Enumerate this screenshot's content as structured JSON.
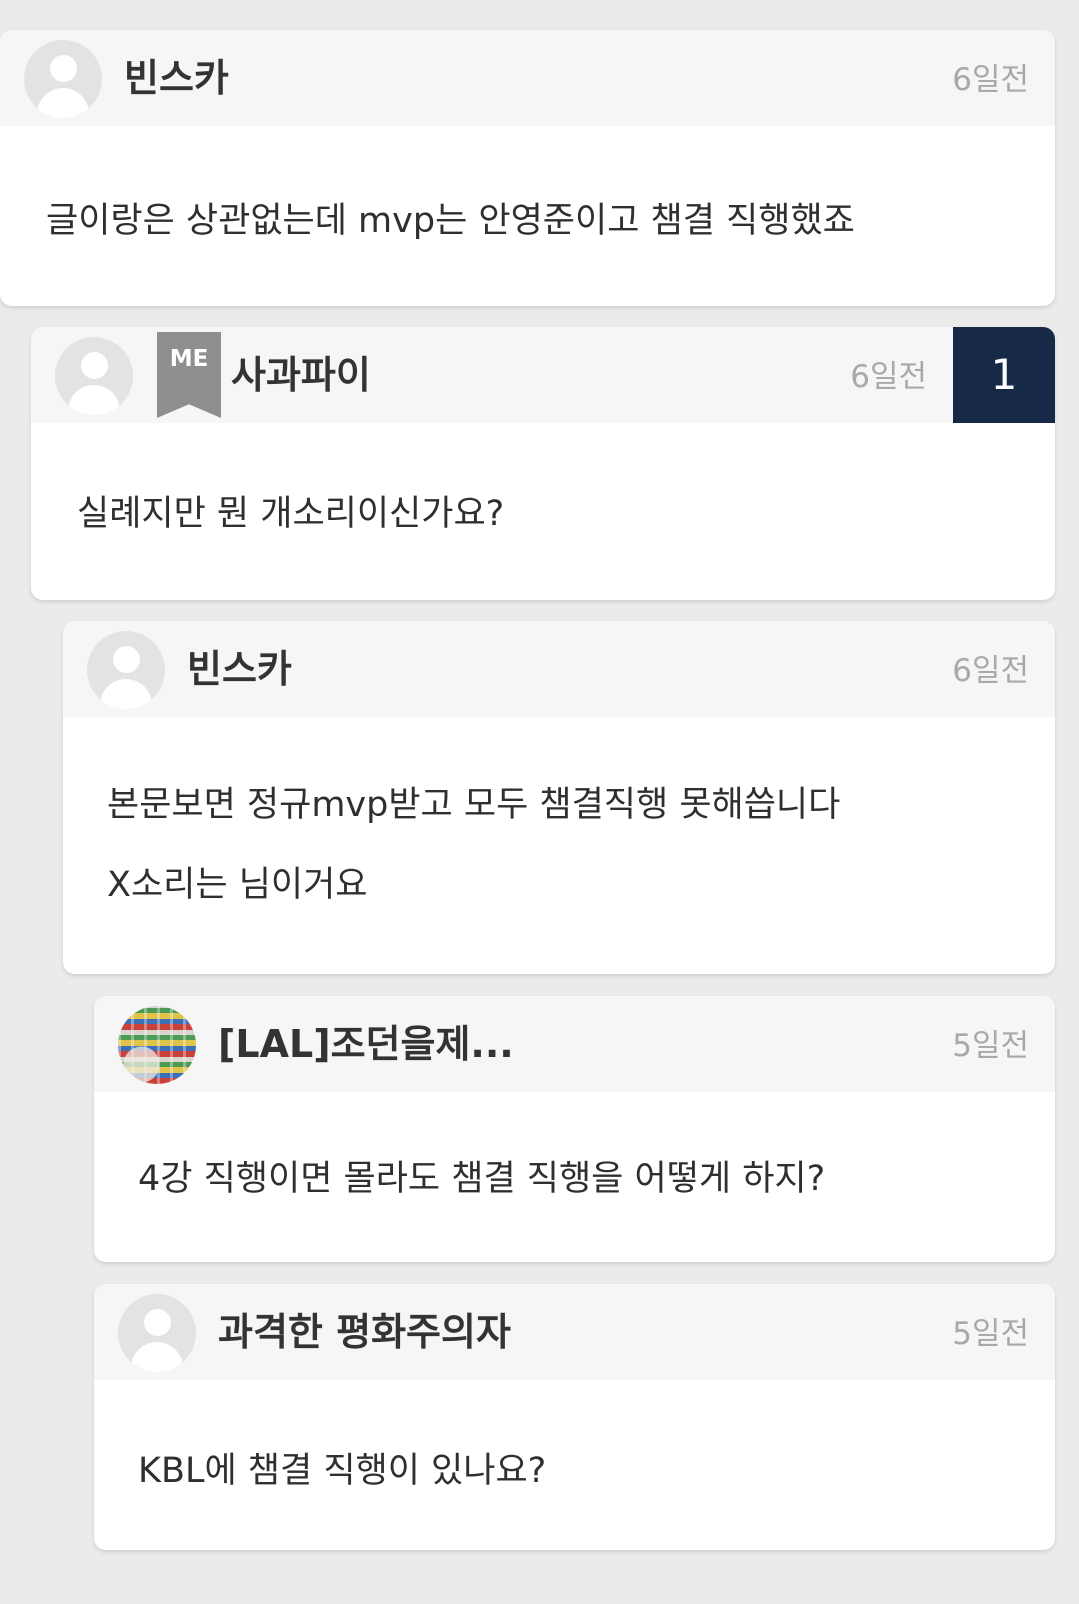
{
  "comments": [
    {
      "username": "빈스카",
      "time": "6일전",
      "avatar_icon": "default-user-avatar-icon",
      "lines": [
        "글이랑은 상관없는데 mvp는 안영준이고 챔결 직행했죠"
      ]
    },
    {
      "username": "사과파이",
      "time": "6일전",
      "avatar_icon": "default-user-avatar-icon",
      "me_badge": "ME",
      "count_badge": "1",
      "lines": [
        "실례지만 뭔 개소리이신가요?"
      ]
    },
    {
      "username": "빈스카",
      "time": "6일전",
      "avatar_icon": "default-user-avatar-icon",
      "lines": [
        "본문보면 정규mvp받고 모두 챔결직행 못해씁니다",
        " X소리는 님이거요"
      ]
    },
    {
      "username": "[LAL]조던을제...",
      "time": "5일전",
      "avatar_icon": "photo-avatar-icon",
      "lines": [
        "4강 직행이면 몰라도 챔결 직행을 어떻게 하지?"
      ]
    },
    {
      "username": "과격한 평화주의자",
      "time": "5일전",
      "avatar_icon": "default-user-avatar-icon",
      "lines": [
        "KBL에 챔결 직행이 있나요?"
      ]
    }
  ],
  "colors": {
    "page_background": "#ebebeb",
    "header_background": "#f6f6f6",
    "count_badge": "#162947",
    "me_badge": "#8f8f8f",
    "timestamp": "#a9a9a9"
  }
}
